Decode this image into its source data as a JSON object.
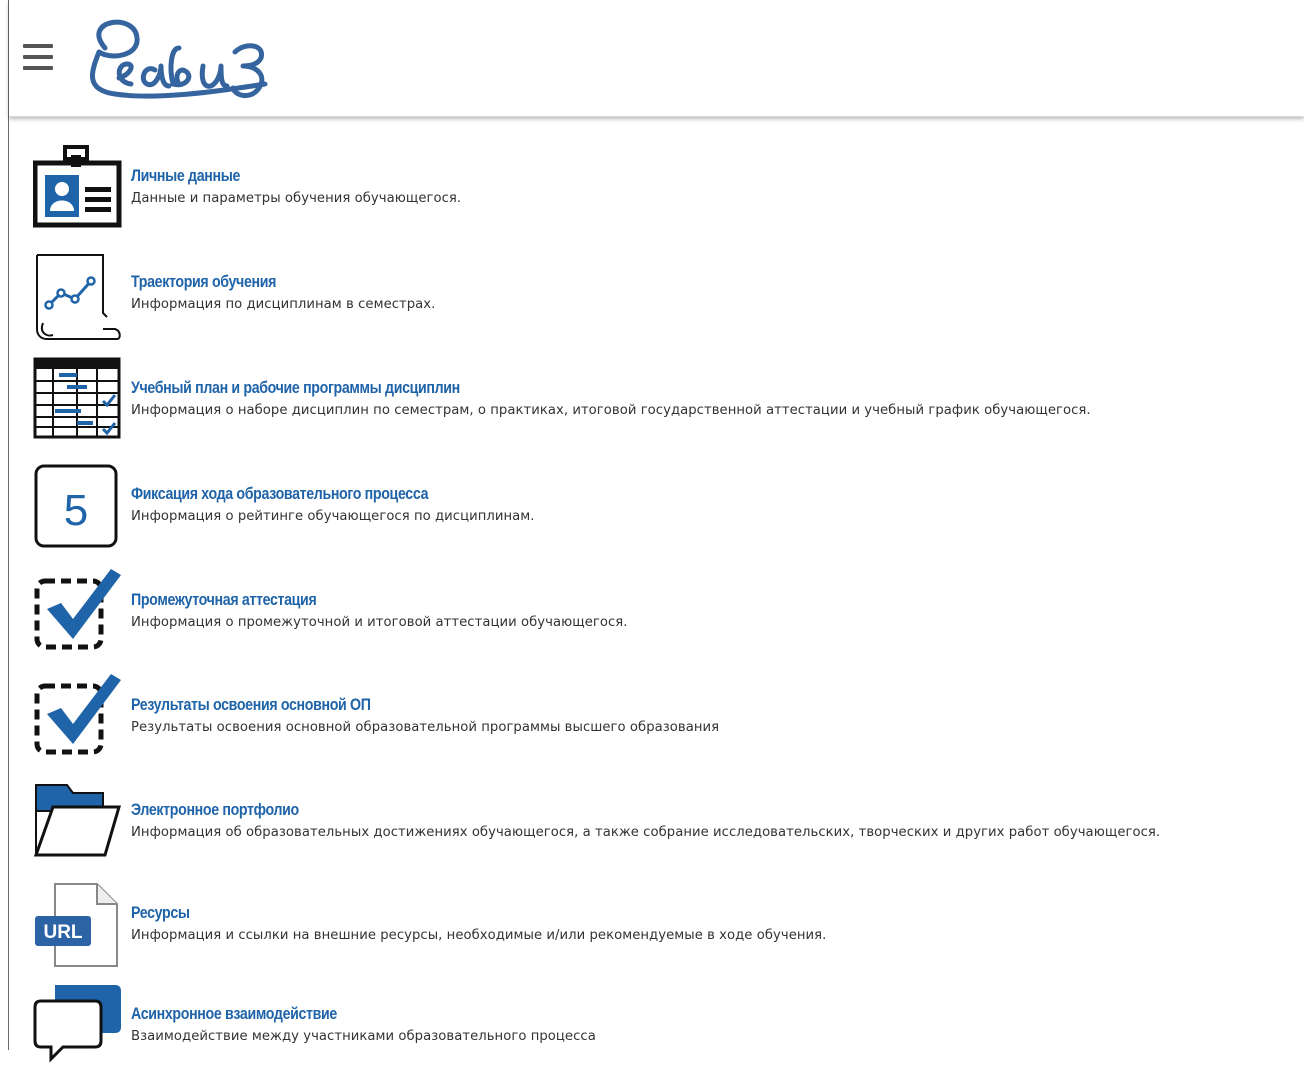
{
  "header": {
    "logo_text": "Реавиз",
    "menu_icon": "hamburger-menu-icon"
  },
  "colors": {
    "accent": "#1f63a9",
    "icon_blue": "#1f63a9",
    "icon_dark": "#111111"
  },
  "menu": {
    "items": [
      {
        "title": "Личные данные",
        "description": "Данные и параметры обучения обучающегося.",
        "icon": "id-badge-icon"
      },
      {
        "title": "Траектория обучения",
        "description": "Информация по дисциплинам в семестрах.",
        "icon": "trajectory-chart-icon"
      },
      {
        "title": "Учебный план и рабочие программы дисциплин",
        "description": "Информация о наборе дисциплин по семестрам, о практиках, итоговой государственной аттестации и учебный график обучающегося.",
        "icon": "schedule-table-icon"
      },
      {
        "title": "Фиксация хода образовательного процесса",
        "description": "Информация о рейтинге обучающегося по дисциплинам.",
        "icon": "grade-five-icon",
        "icon_text": "5"
      },
      {
        "title": "Промежуточная аттестация",
        "description": "Информация о промежуточной и итоговой аттестации обучающегося.",
        "icon": "checkbox-check-icon"
      },
      {
        "title": "Результаты освоения основной ОП",
        "description": "Результаты освоения основной образовательной программы высшего образования",
        "icon": "checkbox-check-icon"
      },
      {
        "title": "Электронное портфолио",
        "description": "Информация об образовательных достижениях обучающегося, а также собрание исследовательских, творческих и других работ обучающегося.",
        "icon": "folder-icon"
      },
      {
        "title": "Ресурсы",
        "description": "Информация и ссылки на внешние ресурсы, необходимые и/или рекомендуемые в ходе обучения.",
        "icon": "url-document-icon",
        "icon_text": "URL"
      },
      {
        "title": "Асинхронное взаимодействие",
        "description": "Взаимодействие между участниками образовательного процесса",
        "icon": "chat-bubbles-icon"
      }
    ]
  }
}
